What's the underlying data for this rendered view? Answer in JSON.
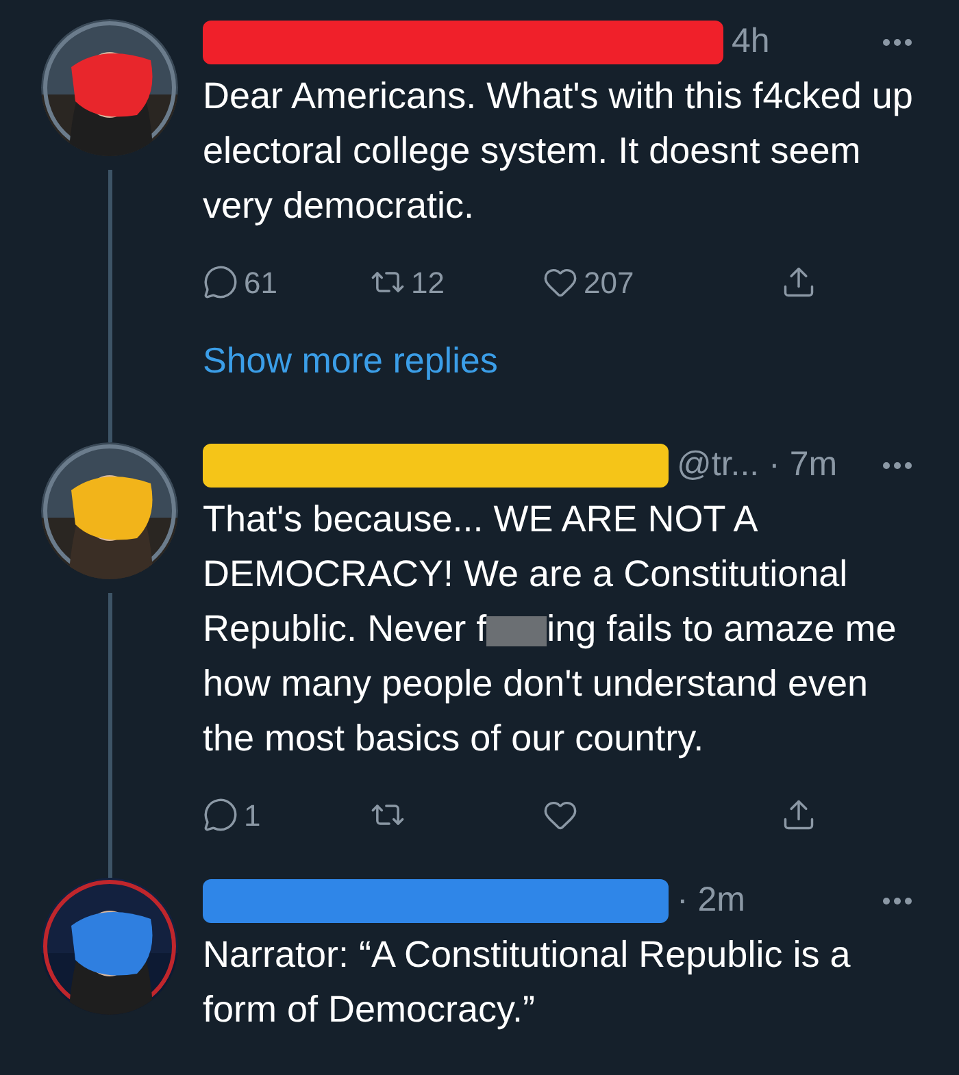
{
  "tweets": [
    {
      "color": "#f0202a",
      "meta": "4h",
      "body": [
        "Dear Americans. What's with this f4cked up electoral college system. It doesnt seem very democratic."
      ],
      "actions": {
        "replies": "61",
        "retweets": "12",
        "likes": "207"
      },
      "thread_line": true,
      "show_more": "Show more replies"
    },
    {
      "color": "#f5c518",
      "meta": "@tr... · 7m",
      "body": [
        "That's because... WE ARE NOT A DEMOCRACY! We are a Constitutional Republic. Never f",
        "ing fails to amaze me how many people don't understand even the most basics of our country."
      ],
      "actions": {
        "replies": "1"
      },
      "thread_line": true
    },
    {
      "color": "#2f86e8",
      "meta": "· 2m",
      "body": [
        "Narrator: “A Constitutional Republic is a form of Democracy.”"
      ],
      "thread_line": false
    }
  ]
}
